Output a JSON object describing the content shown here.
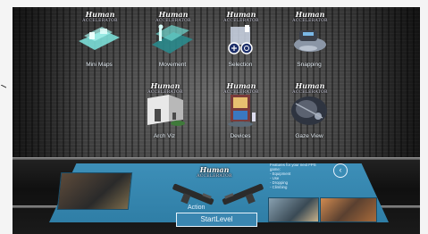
{
  "logo": {
    "title": "Human",
    "subtitle": "ACCELERATOR"
  },
  "tiles": [
    {
      "label": "Mini Maps"
    },
    {
      "label": "Movement"
    },
    {
      "label": "Selection"
    },
    {
      "label": "Snapping"
    },
    {
      "label": "Arch Viz"
    },
    {
      "label": "Devices"
    },
    {
      "label": "Gaze View"
    }
  ],
  "panel": {
    "action_label": "Action",
    "description": "Features for your next FPS\ngame:\n - Equipment\n - Use\n - Dropping\n - Climbing",
    "back_icon": "chevron-left-icon",
    "start_button_label": "StartLevel"
  },
  "colors": {
    "panel": "#3a86b0",
    "label": "#e6eef5"
  }
}
